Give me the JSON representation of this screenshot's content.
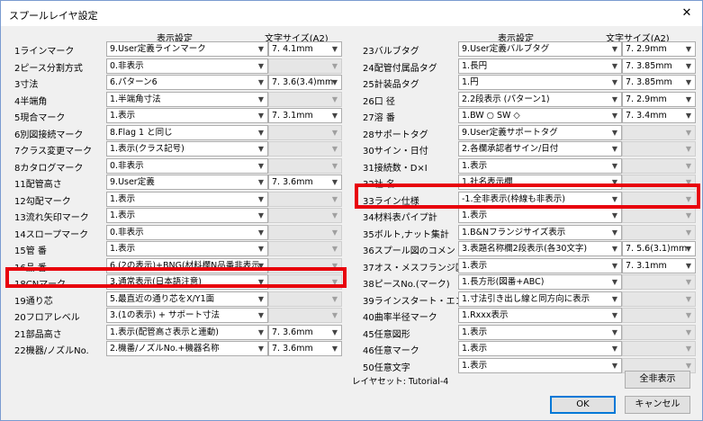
{
  "title": "スプールレイヤ設定",
  "headers": {
    "display": "表示設定",
    "text_size": "文字サイズ(A2)"
  },
  "left_rows": [
    {
      "label": "1ラインマーク",
      "display": "9.User定義ラインマーク",
      "size": "7. 4.1mm",
      "size_enabled": true
    },
    {
      "label": "2ピース分割方式",
      "display": "0.非表示",
      "size": "",
      "size_enabled": false
    },
    {
      "label": "3寸法",
      "display": "6.パターン6",
      "size": "7. 3.6(3.4)mm",
      "size_enabled": true
    },
    {
      "label": "4半端角",
      "display": "1.半端角寸法",
      "size": "",
      "size_enabled": false
    },
    {
      "label": "5現合マーク",
      "display": "1.表示",
      "size": "7. 3.1mm",
      "size_enabled": true
    },
    {
      "label": "6別図接続マーク",
      "display": "8.Flag 1 と同じ",
      "size": "",
      "size_enabled": false
    },
    {
      "label": "7クラス変更マーク",
      "display": "1.表示(クラス記号)",
      "size": "",
      "size_enabled": false
    },
    {
      "label": "8カタログマーク",
      "display": "0.非表示",
      "size": "",
      "size_enabled": false
    },
    {
      "label": "11配管高さ",
      "display": "9.User定義",
      "size": "7. 3.6mm",
      "size_enabled": true
    },
    {
      "label": "12勾配マーク",
      "display": "1.表示",
      "size": "",
      "size_enabled": false
    },
    {
      "label": "13流れ矢印マーク",
      "display": "1.表示",
      "size": "",
      "size_enabled": false
    },
    {
      "label": "14スロープマーク",
      "display": "0.非表示",
      "size": "",
      "size_enabled": false
    },
    {
      "label": "15管 番",
      "display": "1.表示",
      "size": "",
      "size_enabled": false
    },
    {
      "label": "16品 番",
      "display": "6.(2の表示)+BNG(材料欄N品番非表示",
      "size": "",
      "size_enabled": false
    },
    {
      "label": "18CNマーク",
      "display": "3.通常表示(日本語注意)",
      "size": "",
      "size_enabled": false
    },
    {
      "label": "19通り芯",
      "display": "5.最直近の通り芯をX/Y1面",
      "size": "",
      "size_enabled": false
    },
    {
      "label": "20フロアレベル",
      "display": "3.(1の表示) + サポート寸法",
      "size": "",
      "size_enabled": false
    },
    {
      "label": "21部品高さ",
      "display": "1.表示(配管高さ表示と連動)",
      "size": "7. 3.6mm",
      "size_enabled": true
    },
    {
      "label": "22機器/ノズルNo.",
      "display": "2.機番/ノズルNo.+機器名称",
      "size": "7. 3.6mm",
      "size_enabled": true
    }
  ],
  "right_rows": [
    {
      "label": "23バルブタグ",
      "display": "9.User定義バルブタグ",
      "size": "7. 2.9mm",
      "size_enabled": true
    },
    {
      "label": "24配管付属品タグ",
      "display": "1.長円",
      "size": "7. 3.85mm",
      "size_enabled": true
    },
    {
      "label": "25計装品タグ",
      "display": "1.円",
      "size": "7. 3.85mm",
      "size_enabled": true
    },
    {
      "label": "26口 径",
      "display": "2.2段表示 (パターン1)",
      "size": "7. 2.9mm",
      "size_enabled": true
    },
    {
      "label": "27溶 番",
      "display": "1.BW ○ SW ◇",
      "size": "7. 3.4mm",
      "size_enabled": true
    },
    {
      "label": "28サポートタグ",
      "display": "9.User定義サポートタグ",
      "size": "",
      "size_enabled": false
    },
    {
      "label": "30サイン・日付",
      "display": "2.各欄承認者サイン/日付",
      "size": "",
      "size_enabled": false
    },
    {
      "label": "31接続数・D×I",
      "display": "1.表示",
      "size": "",
      "size_enabled": false
    },
    {
      "label": "32社 名",
      "display": "1.社名表示欄",
      "size": "",
      "size_enabled": false
    },
    {
      "label": "33ライン仕様",
      "display": "-1.全非表示(枠線も非表示)",
      "size": "",
      "size_enabled": false
    },
    {
      "label": "34材料表パイプ計",
      "display": "1.表示",
      "size": "",
      "size_enabled": false
    },
    {
      "label": "35ボルト,ナット集計",
      "display": "1.B&Nフランジサイズ表示",
      "size": "",
      "size_enabled": false
    },
    {
      "label": "36スプール図のコメント",
      "display": "3.表題名称欄2段表示(各30文字)",
      "size": "7. 5.6(3.1)mm",
      "size_enabled": true
    },
    {
      "label": "37オス・メスフランジ区分",
      "display": "1.表示",
      "size": "7. 3.1mm",
      "size_enabled": true
    },
    {
      "label": "38ピースNo.(マーク)",
      "display": "1.長方形(図番+ABC)",
      "size": "",
      "size_enabled": false
    },
    {
      "label": "39ラインスタート・エンド",
      "display": "1.寸法引き出し線と同方向に表示",
      "size": "",
      "size_enabled": false
    },
    {
      "label": "40曲率半径マーク",
      "display": "1.Rxxx表示",
      "size": "",
      "size_enabled": false
    },
    {
      "label": "45任意図形",
      "display": "1.表示",
      "size": "",
      "size_enabled": false
    },
    {
      "label": "46任意マーク",
      "display": "1.表示",
      "size": "",
      "size_enabled": false
    },
    {
      "label": "50任意文字",
      "display": "1.表示",
      "size": "",
      "size_enabled": false
    }
  ],
  "layer_set": "レイヤセット: Tutorial-4",
  "buttons": {
    "all_hide": "全非表示",
    "ok": "OK",
    "cancel": "キャンセル"
  },
  "accent": "#e8000b"
}
